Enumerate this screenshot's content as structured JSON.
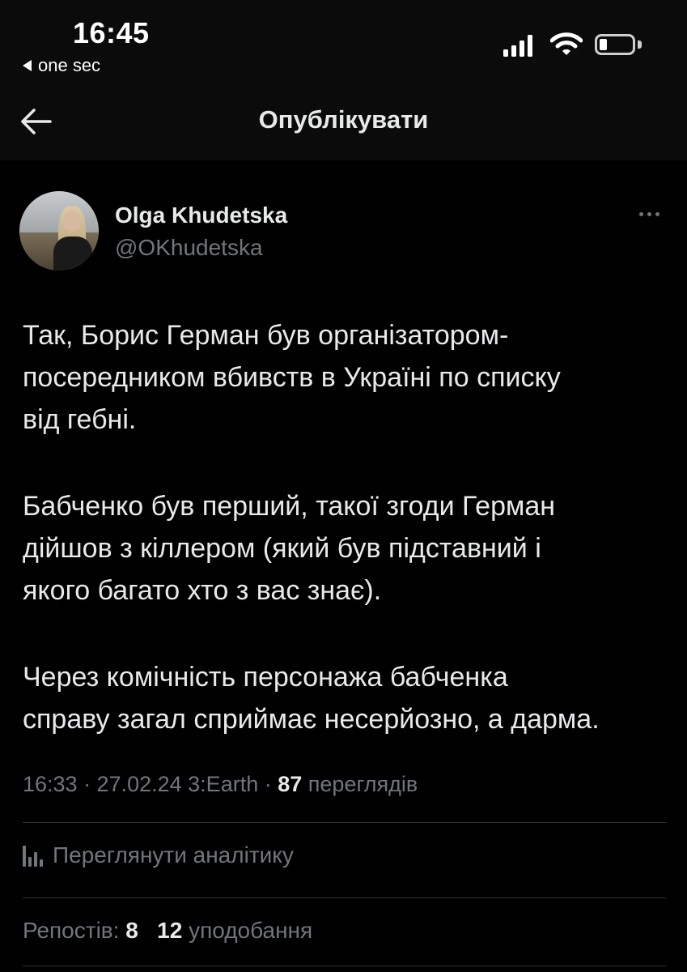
{
  "status_bar": {
    "time": "16:45",
    "back_app_label": "one sec"
  },
  "nav": {
    "title": "Опублікувати"
  },
  "tweet": {
    "author_name": "Olga Khudetska",
    "author_handle": "@OKhudetska",
    "paragraphs": [
      "Так, Борис Герман був організатором-\nпосередником вбивств в Україні по списку\nвід гебні.",
      "Бабченко був перший, такої згоди Герман\nдійшов з кіллером (який був підставний і\nякого багато хто з вас знає).",
      "Через комічність персонажа бабченка\nсправу загал сприймає несерйозно, а дарма."
    ],
    "meta_time": "16:33 · 27.02.24 3:Earth ·",
    "views_count": "87",
    "views_label": "переглядів"
  },
  "analytics": {
    "label": "Переглянути аналітику"
  },
  "stats": {
    "reposts_label": "Репостів:",
    "reposts_count": "8",
    "likes_count": "12",
    "likes_label": "уподобання"
  },
  "colors": {
    "background": "#000000",
    "header_background": "#0b0b0b",
    "text_primary": "#e7e9ea",
    "text_secondary": "#71767b",
    "divider": "#2f3336"
  }
}
